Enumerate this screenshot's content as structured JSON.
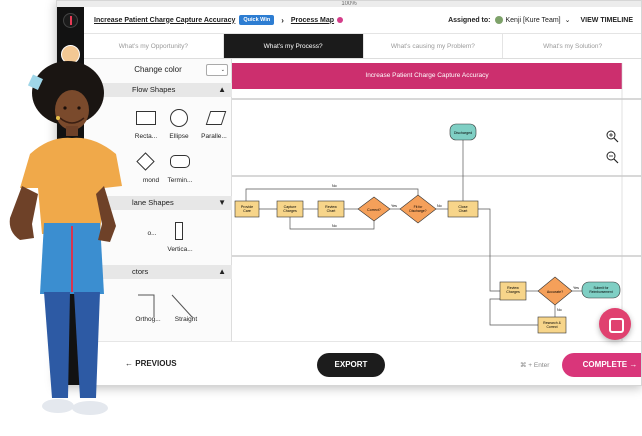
{
  "window": {
    "zoom_label": "100%"
  },
  "header": {
    "project_title": "Increase Patient Charge Capture Accuracy",
    "badge": "Quick Win",
    "section": "Process Map",
    "assigned_label": "Assigned to:",
    "team": "Kenji [Kure Team]",
    "view_timeline": "VIEW TIMELINE"
  },
  "tabs": [
    {
      "label": "What's my Opportunity?",
      "active": false
    },
    {
      "label": "What's my Process?",
      "active": true
    },
    {
      "label": "What's causing my Problem?",
      "active": false
    },
    {
      "label": "What's my Solution?",
      "active": false
    }
  ],
  "panel": {
    "change_color": "Change color",
    "sections": [
      {
        "label": "Flow Shapes",
        "caret": "▲"
      },
      {
        "label": "lane Shapes",
        "caret": "▼"
      },
      {
        "label": "ctors",
        "caret": "▲"
      }
    ],
    "flow_shapes": [
      "Recta...",
      "Ellipse",
      "Paralle...",
      "mond",
      "Termin..."
    ],
    "lane_shapes": [
      "o...",
      "Vertica..."
    ],
    "connectors": [
      "Orthog...",
      "Straight"
    ]
  },
  "diagram": {
    "title": "Increase Patient Charge Capture Accuracy",
    "nodes": {
      "provide_care": "Provide Care",
      "capture_charges": "Capture Charges",
      "review_chart": "Review Chart",
      "correct": "Correct?",
      "fit_discharge": "Fit for Discharge?",
      "close_chart": "Close Chart",
      "discharged": "Discharged",
      "review_charges": "Review Charges",
      "accurate": "Accurate?",
      "submit_reimbursement": "Submit for Reimbursement",
      "research_correct": "Research & Correct"
    },
    "edge_labels": {
      "no": "No",
      "yes": "Yes"
    }
  },
  "bottom": {
    "previous": "PREVIOUS",
    "export": "EXPORT",
    "hint": "⌘ + Enter",
    "complete": "COMPLETE →"
  },
  "colors": {
    "accent_pink": "#cc2f6e",
    "complete_pink": "#d9367a",
    "task_fill": "#f7d58a",
    "decision_fill": "#f5a05a",
    "terminal_fill": "#7fcfc4",
    "badge_blue": "#2d7dd2"
  }
}
